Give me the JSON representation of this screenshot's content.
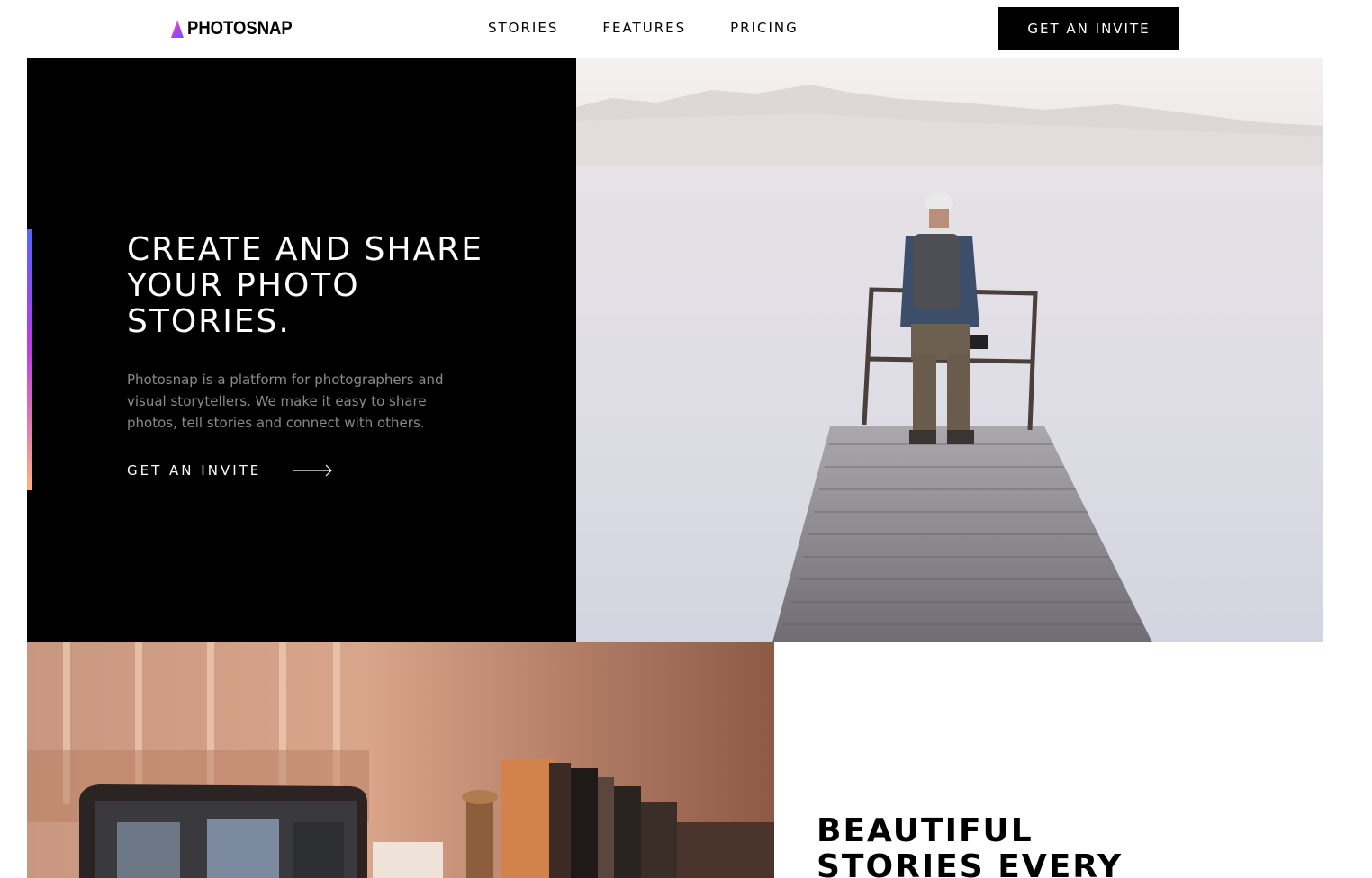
{
  "header": {
    "logo_text": "PHOTOSNAP",
    "nav": [
      "STORIES",
      "FEATURES",
      "PRICING"
    ],
    "cta_label": "GET AN INVITE"
  },
  "hero": {
    "title": "CREATE AND SHARE YOUR PHOTO STORIES.",
    "description": "Photosnap is a platform for photographers and visual storytellers. We make it easy to share photos, tell stories and connect with others.",
    "cta_label": "GET AN INVITE",
    "cta_icon": "arrow-right-icon"
  },
  "section2": {
    "title": "BEAUTIFUL STORIES EVERY TIME"
  },
  "colors": {
    "accent_gradient": [
      "#5165ff",
      "#bd3ce4",
      "#fdb37f"
    ],
    "dark": "#000000",
    "muted_text": "#8a8a8a"
  }
}
